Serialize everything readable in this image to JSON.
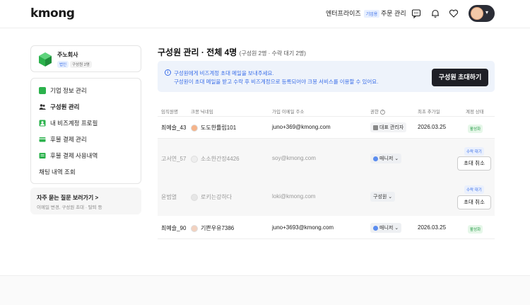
{
  "header": {
    "logo": "kmong",
    "enterprise_label": "엔터프라이즈",
    "enterprise_badge": "기업용",
    "orders_label": "주문 관리"
  },
  "sidebar": {
    "company_name": "주노회사",
    "corp_tag": "법인",
    "member_tag": "구성원 2명",
    "items": [
      {
        "label": "기업 정보 관리",
        "icon": "building-icon",
        "color": "#2bb24c"
      },
      {
        "label": "구성원 관리",
        "icon": "people-icon",
        "color": "#333333"
      },
      {
        "label": "내 비즈계정 프로필",
        "icon": "profile-icon",
        "color": "#2bb24c"
      },
      {
        "label": "후불 결제 관리",
        "icon": "card-icon",
        "color": "#2bb24c"
      },
      {
        "label": "후불 결제 사용내역",
        "icon": "receipt-icon",
        "color": "#2bb24c"
      },
      {
        "label": "채팅 내역 조회",
        "icon": "",
        "color": ""
      }
    ],
    "active_index": 1,
    "faq_title": "자주 묻는 질문 보러가기 >",
    "faq_sub": "이메일 변경, 구성원 초대 · 탈퇴 등"
  },
  "main": {
    "title": "구성원 관리 · 전체 4명",
    "title_sub": "(구성원 2명 · 수락 대기 2명)",
    "banner_line1": "구성원에게 비즈계정 초대 메일을 보내주세요.",
    "banner_line2": "구성원이 초대 메일을 받고 수락 후 비즈계정으로 등록되어야 크몽 서비스를 이용할 수 있어요.",
    "invite_button": "구성원 초대하기",
    "columns": [
      "임직원명",
      "크몽 닉네임",
      "가입 이메일 주소",
      "권한",
      "최초 추가일",
      "계정 상태"
    ],
    "rows": [
      {
        "name": "최예슬_43",
        "nickname": "도도한튤립101",
        "email": "juno+369@kmong.com",
        "role": "대표 관리자",
        "added": "2026.03.25",
        "status": "활성화",
        "pending": false,
        "cancel": ""
      },
      {
        "name": "고서연_57",
        "nickname": "소소한간장4426",
        "email": "soy@kmong.com",
        "role": "매니저",
        "added": "",
        "status": "수락 대기",
        "pending": true,
        "cancel": "초대 취소"
      },
      {
        "name": "윤범열",
        "nickname": "로키는강하다",
        "email": "loki@kmong.com",
        "role": "구성원",
        "added": "",
        "status": "수락 대기",
        "pending": true,
        "cancel": "초대 취소"
      },
      {
        "name": "최예슬_90",
        "nickname": "기쁜우유7386",
        "email": "juno+3693@kmong.com",
        "role": "매니저",
        "added": "2026.03.25",
        "status": "활성화",
        "pending": false,
        "cancel": ""
      }
    ]
  }
}
